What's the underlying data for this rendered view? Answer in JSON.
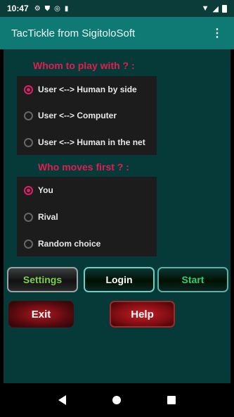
{
  "status_bar": {
    "time": "10:47"
  },
  "app_bar": {
    "title": "TacTickle from SigitoloSoft",
    "overflow_glyph": "⋮"
  },
  "play_with": {
    "title": "Whom to play with ? :",
    "options": [
      {
        "label": "User <--> Human by side",
        "checked": true
      },
      {
        "label": "User <--> Computer",
        "checked": false
      },
      {
        "label": "User <--> Human in the net",
        "checked": false
      }
    ]
  },
  "moves_first": {
    "title": "Who moves first ? :",
    "options": [
      {
        "label": "You",
        "checked": true
      },
      {
        "label": "Rival",
        "checked": false
      },
      {
        "label": "Random choice",
        "checked": false
      }
    ]
  },
  "buttons": {
    "settings": "Settings",
    "login": "Login",
    "start": "Start",
    "exit": "Exit",
    "help": "Help"
  },
  "colors": {
    "app_bar": "#0f7a73",
    "background": "#063a38",
    "accent_title": "#e01e4e",
    "radio_checked": "#e0206a"
  }
}
